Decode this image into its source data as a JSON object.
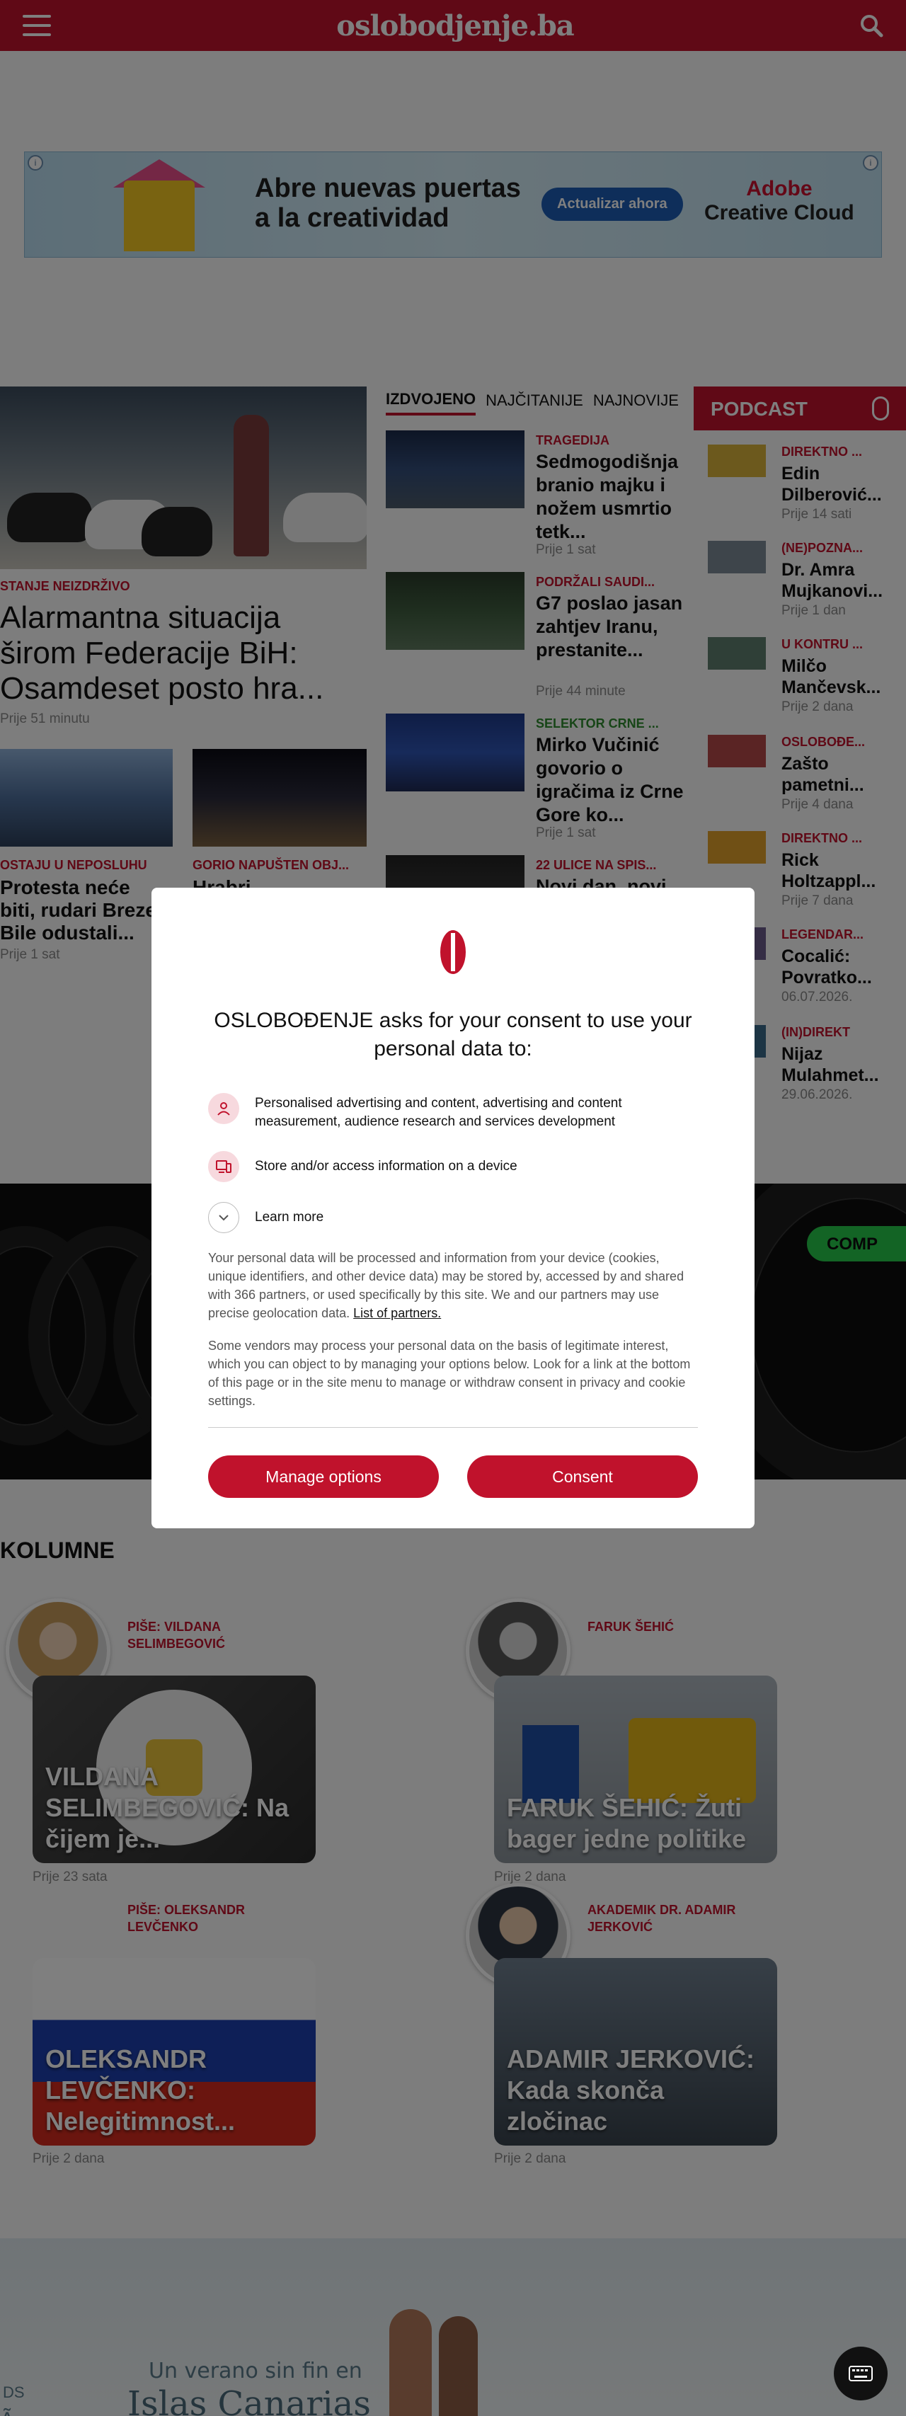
{
  "header": {
    "logo": "oslobodjenje.ba",
    "menu_icon": "hamburger-icon",
    "search_icon": "search-icon"
  },
  "ad_top": {
    "headline_line1": "Abre nuevas puertas",
    "headline_line2": "a la creatividad",
    "cta": "Actualizar ahora",
    "brand_line1": "Adobe",
    "brand_line2": "Creative Cloud"
  },
  "hero": {
    "kicker": "STANJE NEIZDRŽIVO",
    "title": "Alarmantna situacija širom Federacije BiH: Osamdeset posto hra...",
    "time": "Prije 51 minutu"
  },
  "subnews": [
    {
      "kicker": "OSTAJU U NEPOSLUHU",
      "title": "Protesta neće biti, rudari Breze i Bile odustali...",
      "time": "Prije 1 sat"
    },
    {
      "kicker": "GORIO NAPUŠTEN OBJ...",
      "title": "Hrabri sarajevski...",
      "time": ""
    }
  ],
  "tabs": [
    "IZDVOJENO",
    "NAJČITANIJE",
    "NAJNOVIJE"
  ],
  "featured": [
    {
      "kicker": "TRAGEDIJA",
      "kicker_color": "#c0122c",
      "title": "Sedmogodišnja branio majku i nožem usmrtio tetk...",
      "time": "Prije 1 sat"
    },
    {
      "kicker": "PODRŽALI SAUDI...",
      "kicker_color": "#c0122c",
      "title": "G7 poslao jasan zahtjev Iranu, prestanite...",
      "time": "Prije 44 minute"
    },
    {
      "kicker": "SELEKTOR CRNE ...",
      "kicker_color": "#2e8b2e",
      "title": "Mirko Vučinić govorio o igračima iz Crne Gore ko...",
      "time": "Prije 1 sat"
    },
    {
      "kicker": "22 ULICE NA SPIS...",
      "kicker_color": "#c0122c",
      "title": "Novi dan, novi...",
      "time": ""
    }
  ],
  "podcast": {
    "title": "PODCAST",
    "items": [
      {
        "kicker": "DIREKTNO ...",
        "title": "Edin Dilberović...",
        "time": "Prije 14 sati"
      },
      {
        "kicker": "(NE)POZNA...",
        "title": "Dr. Amra Mujkanovi...",
        "time": "Prije 1 dan"
      },
      {
        "kicker": "U KONTRU ...",
        "title": "Milčo Mančevsk...",
        "time": "Prije 2 dana"
      },
      {
        "kicker": "OSLOBOĐE...",
        "title": "Zašto pametni...",
        "time": "Prije 4 dana"
      },
      {
        "kicker": "DIREKTNO ...",
        "title": "Rick Holtzappl...",
        "time": "Prije 7 dana"
      },
      {
        "kicker": "LEGENDAR...",
        "title": "Cocalić: Povratko...",
        "time": "06.07.2026."
      },
      {
        "kicker": "(IN)DIREKT",
        "title": "Nijaz Mulahmet...",
        "time": "29.06.2026."
      }
    ]
  },
  "tire_ad": {
    "pill": "COMP"
  },
  "kolumne": {
    "title": "KOLUMNE",
    "items": [
      {
        "author_line1": "PIŠE: VILDANA",
        "author_line2": "SELIMBEGOVIĆ",
        "caption": "VILDANA SELIMBEGOVIĆ: Na čijem je...",
        "time": "Prije 23 sata"
      },
      {
        "author_line1": "FARUK ŠEHIĆ",
        "author_line2": "",
        "caption": "FARUK ŠEHIĆ: Žuti bager jedne politike",
        "time": "Prije 2 dana"
      },
      {
        "author_line1": "PIŠE: OLEKSANDR",
        "author_line2": "LEVČENKO",
        "caption": "OLEKSANDR LEVČENKO: Nelegitimnost...",
        "time": "Prije 2 dana"
      },
      {
        "author_line1": "AKADEMIK DR. ADAMIR",
        "author_line2": "JERKOVIĆ",
        "caption": "ADAMIR JERKOVIĆ: Kada skonča zločinac",
        "time": "Prije 2 dana"
      }
    ]
  },
  "ad_bottom": {
    "sub": "Un verano sin fin en",
    "big": "Islas Canarias",
    "left_text_1": "Ã",
    "left_text_2": "DS"
  },
  "consent": {
    "title": "OSLOBOĐENJE asks for your consent to use your personal data to:",
    "purposes": [
      {
        "icon": "person-icon",
        "text": "Personalised advertising and content, advertising and content measurement, audience research and services development"
      },
      {
        "icon": "device-icon",
        "text": "Store and/or access information on a device"
      }
    ],
    "learn_more": "Learn more",
    "body1": "Your personal data will be processed and information from your device (cookies, unique identifiers, and other device data) may be stored by, accessed by and shared with 366 partners, or used specifically by this site. We and our partners may use precise geolocation data.",
    "partners_link": "List of partners.",
    "body2": "Some vendors may process your personal data on the basis of legitimate interest, which you can object to by managing your options below. Look for a link at the bottom of this page or in the site menu to manage or withdraw consent in privacy and cookie settings.",
    "manage_button": "Manage options",
    "consent_button": "Consent"
  },
  "colors": {
    "brand": "#c0122c",
    "green_kicker": "#2e8b2e"
  }
}
